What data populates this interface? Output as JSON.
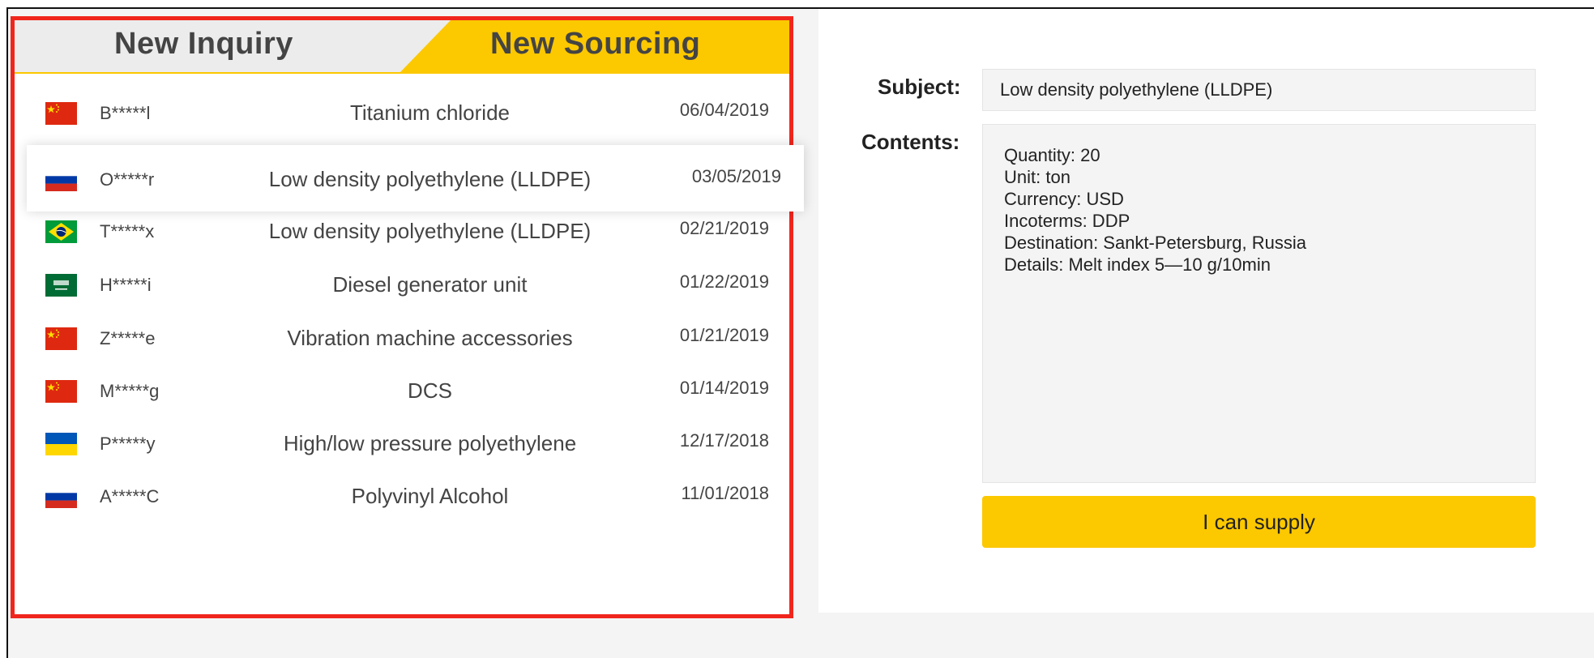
{
  "tabs": {
    "inquiry_label": "New Inquiry",
    "sourcing_label": "New Sourcing",
    "active": "sourcing",
    "active_color": "#fcc800"
  },
  "rows": [
    {
      "flag": "china-flag",
      "user": "B*****l",
      "subject": "Titanium chloride",
      "date": "06/04/2019"
    },
    {
      "flag": "russia-flag",
      "user": "O*****r",
      "subject": "Low density polyethylene (LLDPE)",
      "date": "03/05/2019",
      "selected": true
    },
    {
      "flag": "brazil-flag",
      "user": "T*****x",
      "subject": "Low density polyethylene (LLDPE)",
      "date": "02/21/2019"
    },
    {
      "flag": "saudi-arabia-flag",
      "user": "H*****i",
      "subject": "Diesel generator unit",
      "date": "01/22/2019"
    },
    {
      "flag": "china-flag",
      "user": "Z*****e",
      "subject": "Vibration machine accessories",
      "date": "01/21/2019"
    },
    {
      "flag": "china-flag",
      "user": "M*****g",
      "subject": "DCS",
      "date": "01/14/2019"
    },
    {
      "flag": "ukraine-flag",
      "user": "P*****y",
      "subject": "High/low pressure polyethylene",
      "date": "12/17/2018"
    },
    {
      "flag": "russia-flag",
      "user": "A*****C",
      "subject": "Polyvinyl Alcohol",
      "date": "11/01/2018"
    }
  ],
  "detail": {
    "subject_label": "Subject:",
    "subject_value": "Low density polyethylene (LLDPE)",
    "contents_label": "Contents:",
    "contents_lines": [
      "Quantity: 20",
      "Unit: ton",
      "Currency: USD",
      "Incoterms: DDP",
      "Destination: Sankt-Petersburg, Russia",
      "Details: Melt index 5—10 g/10min"
    ],
    "button_label": "I can supply",
    "button_color": "#fcc800"
  },
  "highlight_color": "#f0261d"
}
